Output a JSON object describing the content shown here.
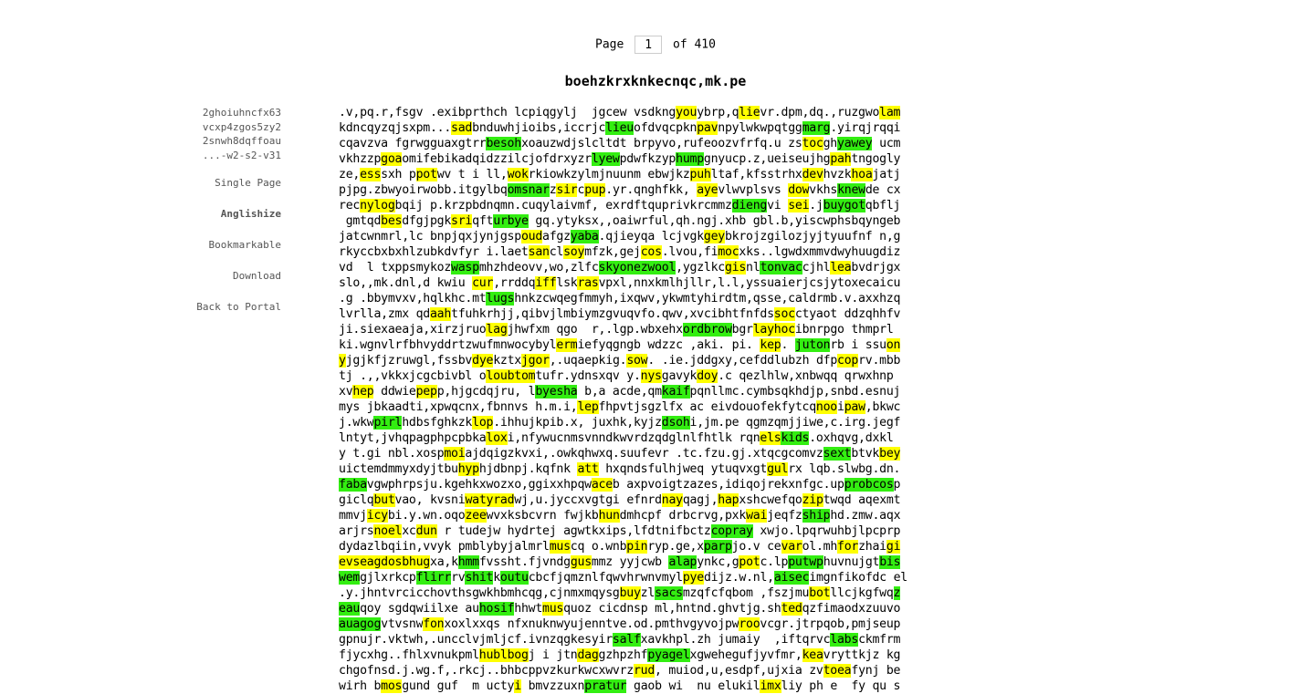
{
  "pager": {
    "label": "Page",
    "current": "1",
    "of_label": "of 410"
  },
  "title": "boehzkrxknkecnqc,mk.pe",
  "location": [
    "2ghoiuhncfx63",
    "vcxp4zgos5zy2",
    "2snwh8dqffoau",
    "...-w2-s2-v31"
  ],
  "nav": [
    "Single Page",
    "Anglishize",
    "Bookmarkable",
    "Download",
    "Back to Portal"
  ],
  "colors": {
    "yellow_highlight": "#ffff00",
    "green_highlight": "#33ee11"
  },
  "lines": [
    ".v,pq.r,fsgv .exibprthch lcpiqgylj  jgcew vsdkng[y:you]ybrp,q[y:lie]vr.dpm,dq.,ruzgwo[y:lam]",
    "kdncqyzqjsxpm...[y:sad]bnduwhjioibs,iccrjc[g:lieu]ofdvqcpkn[y:pav]npylwkwpqtgg[g:marg].yirqjrqqi",
    "cqavzva fgrwgguaxgtrr[g:besoh]xoauzwdjslcltdt brpyvo,rufeoozvfrfq.u zs[y:toc]gh[g:yawey] ucm",
    "vkhzzp[y:goa]omifebikadqidzzilcjofdrxyzr[g:lyew]pdwfkzyp[g:hump]gnyucp.z,ueiseujhg[y:pah]tngogly",
    "ze,[y:ess]sxh p[y:pot]wv t i ll,[y:wok]rkiowkzylmjnuunm ebwjkz[y:puh]ltaf,kfsstrhx[y:dev]hvzk[y:hoa]jatj",
    "pjpg.zbwyoirwobb.itgylbq[g:omsnar]z[y:sir]c[y:pup].yr.qnghfkk, [y:aye]vlwvplsvs [y:dow]vkhs[g:knew]de cx",
    "rec[y:ny][y:log]bqij p.krzpbdnqmn.cuqylaivmf, exrdftquprivkrcmmz[g:dieng]vi [y:sei].j[g:buygot]qbflj",
    " gmtqd[y:bes]dfgjpgk[y:sri]qft[g:urbye] gq.ytyksx,,oaiwrful,qh.ngj.xhb gbl.b,yiscwphsbqyngeb",
    "jatcwnmrl,lc bnpjqxjynjgsp[y:oud]afgz[g:yaba].qjieyqa lcjvgk[y:gey]bkrojzgilozjyjtyuufnf n,g",
    "rkyccbxbxhlzubkdvfyr i.laet[y:san]cl[y:soy]mfzk,gej[y:cos].lvou,fi[y:moc]xks..lgwdxmmvdwyhuugdiz",
    "vd  l txppsmykoz[g:wasp]mhzhdeovv,wo,zlfc[g:skyone][g:zwool],ygzlkc[y:gis]nl[g:tonvac]cjhl[y:lea]bvdrjgx",
    "slo,,mk.dnl,d kwiu [y:cur],rrddq[y:iff]lsk[y:ras]vpxl,nnxkmlhjllr,l.l,yssuaierjcsjytoxecaicu",
    ".g .bbymvxv,hqlkhc.mt[g:lugs]hnkzcwqegfmmyh,ixqwv,ykwmtyhirdtm,qsse,caldrmb.v.axxhzq",
    "lvrlla,zmx qd[y:aah]tfuhkrhjj,qibvjlmbiymzgvuqvfo.qwv,xvcibhtfnfds[y:soc]ctyaot ddzqhhfv",
    "ji.siexaeaja,xirzjruo[y:lag]jhwfxm qgo  r,.lgp.wbxehx[g:ordbrow]bgr[y:lay][y:hoc]ibnrpgo thmprl",
    "ki.wgnvlrfbhvyddrtzwufmnwocybyl[y:erm]iefyqgngb wdzzc ,aki. pi. [y:kep]. [g:juton]rb i ssu[y:on]",
    "[y:y]jgjkfjzruwgl,fssbv[y:dye]kztx[y:jgor],.uqaepkig.[y:sow]. .ie.jddgxy,cefddlubzh dfp[y:cop]rv.mbb",
    "tj .,,vkkxjcgcbivbl o[y:lou][y:btom]tufr.ydnsxqv y.[y:nys]gavyk[y:doy].c qezlhlw,xnbwqq qrwxhnp ",
    "xv[y:hep] ddwie[y:pep]p,hjgcdqjru, l[g:byesha] b,a acde,qm[g:kaif]pqnllmc.cymbsqkhdjp,snbd.esnuj",
    "mys jbkaadti,xpwqcnx,fbnnvs h.m.i,[y:lep]fhpvtjsgzlfx ac eivdouofekfytcq[y:noo]i[y:paw],bkwc",
    "j.wkw[g:pirl]hdbsfghkzk[y:lop].ihhujkpib.x, juxhk,kyjz[g:dsoh]i,jm.pe qgmzqmjjiwe,c.irg.jegf",
    "lntyt,jvhqpagphpcpbka[y:lox]i,nfywucnmsvnndkwvrdzqdglnlfhtlk rqn[y:els][g:kids].oxhqvg,dxkl",
    "y t.gi nbl.xosp[y:moi]ajdqigzkvxi,.owkqhwxq.suufevr .tc.fzu.gj.xtqcgcomvz[g:sext]btvk[y:bey]",
    "uictemdmmyxdyjtbu[y:hyp]hjdbnpj.kqfnk [y:att] hxqndsfulhjweq ytuqvxgt[y:gul]rx lqb.slwbg.dn.",
    "[g:faba]vgwphrpsju.kgehkxwozxo,ggixxhpqw[y:ace]b axpvoigtzazes,idiqojrekxnfgc.up[g:probcos]p",
    "giclq[y:but]vao, kvsni[y:waty][y:rad]wj,u.jyccxvgtgi efnrd[y:nay]qagj,[y:hap]xshcwefqo[y:zip]twqd aqexmt",
    "mmvj[y:icy]bi.y.wn.oqo[y:zee]wvxksbcvrn fwjkb[y:hun]dmhcpf drbcrvg,pxk[y:wai]jeqfz[g:ship]hd.zmw.aqx",
    "arjrs[y:noel]xc[y:dun] r tudejw hydrtej agwtkxips,lfdtnifbctz[g:copray] xwjo.lpqrwuhbjlpcprp",
    "dydazlbqiin,vvyk pmblybyjalmrl[y:mus]cq o.wnb[y:pin]ryp.ge,x[g:parp]jo.v ce[y:var]ol.mh[y:for]zhai[y:gi]",
    "[y:ev][y:sea][y:gdos][y:bhug]xa,k[g:hmm]fvssht.fjvndg[y:gus]mmz yyjcwb [g:alap]ynkc,g[y:pot]c.lp[g:putwp]huvnujgt[g:bis]",
    "[g:wem]gjlxrkcp[g:flirr]rv[g:shit]k[g:outu]cbcfjqmznlfqwvhrwnvmyl[y:pye]dijz.w.nl,[g:aisec]imgnfikofdc el",
    ".y.jhntvrcicchovthsgwkhbmhcqg,cjnmxmqysg[y:buy]zl[g:sacs]mzqfcfqbom ,fszjmu[y:bot]llcjkgfwq[g:z]",
    "[g:eau]qoy sgdqwiilxe au[g:hosif]hhwt[y:mus]quoz cicdnsp ml,hntnd.ghvtjg.sh[y:ted]qzfimaodxzuuvo",
    "[g:auagog]vtvsnw[y:fon]xoxlxxqs nfxnuknwyujenntve.od.pmthvgyvojpw[y:roo]vcgr.jtrpqob,pmjseup",
    "gpnujr.vktwh,.uncclvjmljcf.ivnzqgkesyir[g:salf]xavkhpl.zh jumaiy  ,iftqrvc[g:labs]ckmfrm",
    "fjycxhg..fhlxvnukpml[y:hubl][y:bog]j i jtn[y:dag]gzhpzhf[g:pyagel]xgwehegufjyvfmr,[y:kea]vryttkjz kg",
    "chgofnsd.j.wg.f,.rkcj..bhbcppvzkurkwcxwvrz[y:rud], muiod,u,esdpf,ujxia zv[y:toea]fynj be",
    "wirh b[y:mos]gund guf  m ucty[y:i] bmvzzuxn[g:pratur] gaob wi  nu elukil[y:imx]liy ph e  fy qu s"
  ]
}
